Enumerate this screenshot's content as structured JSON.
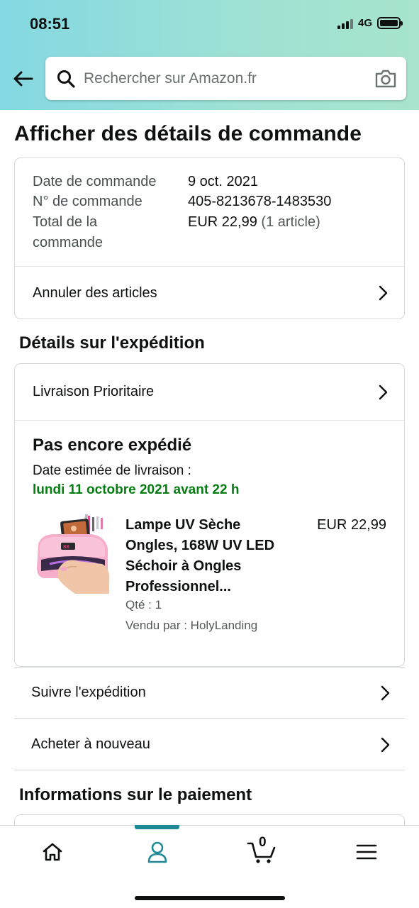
{
  "status_bar": {
    "time": "08:51",
    "network": "4G"
  },
  "search": {
    "placeholder": "Rechercher sur Amazon.fr"
  },
  "page_title": "Afficher des détails de commande",
  "order_summary": {
    "date_label": "Date de commande",
    "date_value": "9 oct. 2021",
    "number_label": "N° de commande",
    "number_value": "405-8213678-1483530",
    "total_label_line1": "Total de la",
    "total_label_line2": "commande",
    "total_value": "EUR 22,99",
    "total_count": "(1 article)",
    "cancel_label": "Annuler des articles"
  },
  "shipping": {
    "section_title": "Détails sur l'expédition",
    "delivery_option": "Livraison Prioritaire",
    "status": "Pas encore expédié",
    "estimate_label": "Date estimée de livraison :",
    "estimate_date": "lundi 11 octobre 2021 avant 22 h",
    "item": {
      "title": "Lampe UV Sèche Ongles, 168W UV LED Séchoir à Ongles Professionnel...",
      "price": "EUR 22,99",
      "qty": "Qté : 1",
      "seller": "Vendu par : HolyLanding"
    },
    "track_label": "Suivre l'expédition",
    "buy_again_label": "Acheter à nouveau"
  },
  "payment": {
    "section_title": "Informations sur le paiement"
  },
  "bottom_nav": {
    "active": "account",
    "cart_count": "0",
    "accent_color": "#1f8a95",
    "items": [
      "home-icon",
      "account-icon",
      "cart-icon",
      "menu-icon"
    ]
  },
  "colors": {
    "delivery_green": "#067d12",
    "border": "#d5d9d9"
  }
}
